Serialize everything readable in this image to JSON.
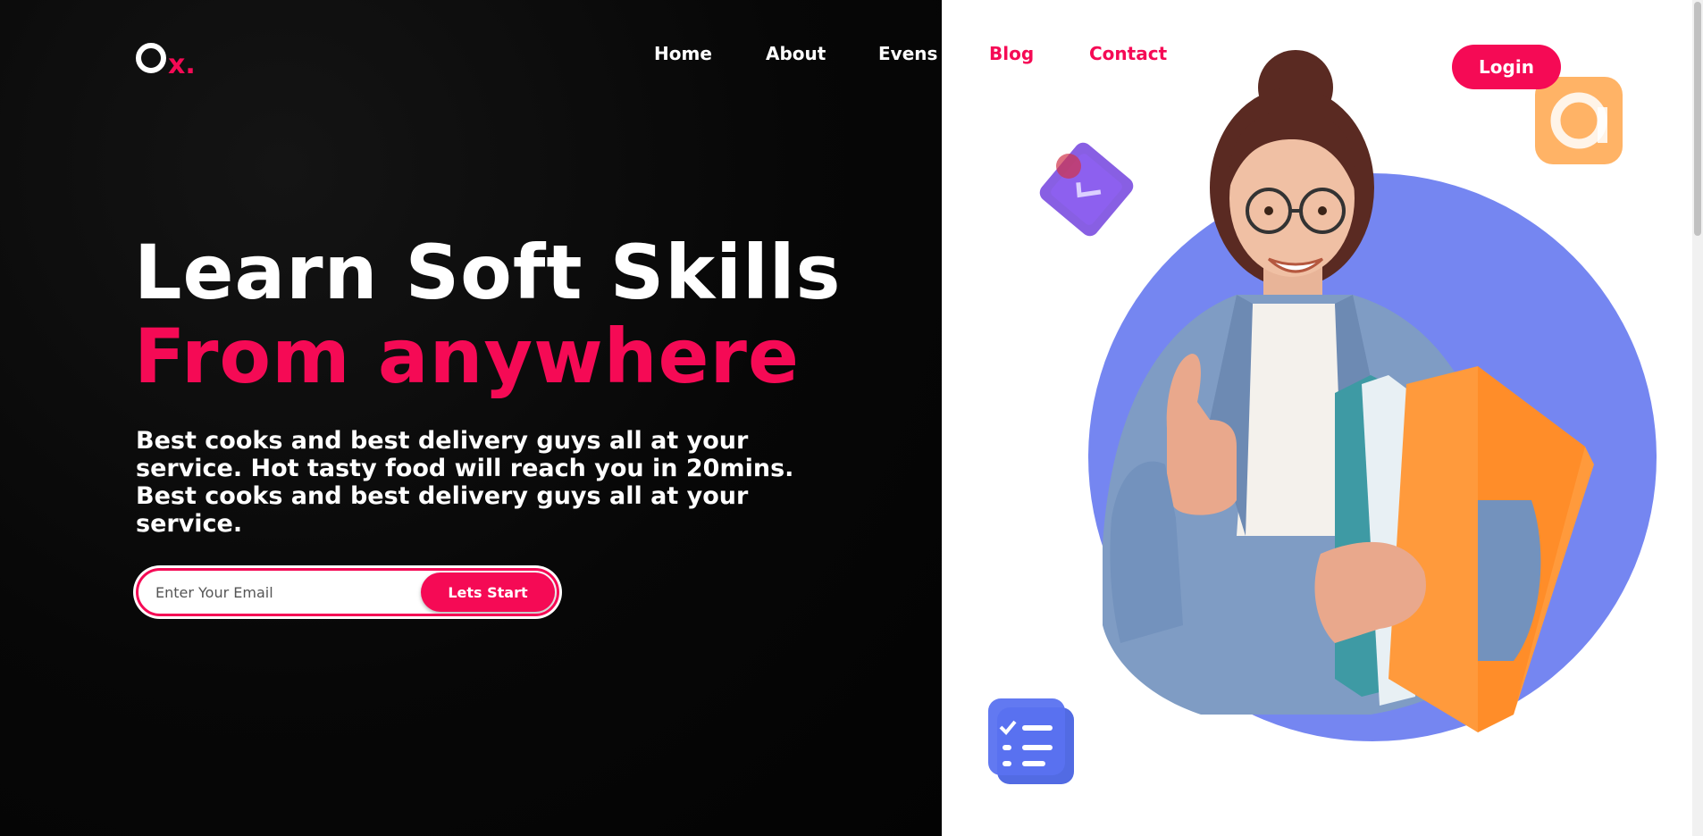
{
  "header": {
    "logo": {
      "letter_o": "O",
      "letter_x": "x."
    },
    "nav": [
      {
        "label": "Home"
      },
      {
        "label": "About"
      },
      {
        "label": "Evens"
      },
      {
        "label": "Blog"
      },
      {
        "label": "Contact"
      }
    ],
    "login_label": "Login"
  },
  "hero": {
    "title_line1": "Learn Soft Skills",
    "title_line2": "From anywhere",
    "description": "Best cooks and best delivery guys all at your service. Hot tasty food will reach you in 20mins. Best cooks and best delivery guys all at your service.",
    "email_placeholder": "Enter Your Email",
    "cta_label": "Lets Start"
  },
  "illustration": {
    "subject": "student-with-books",
    "icons": [
      "calendar-badge-icon",
      "at-sign-badge-icon",
      "checklist-badge-icon"
    ]
  },
  "colors": {
    "accent": "#f50a55",
    "dark_bg": "#050505",
    "circle": "#6e7ff0",
    "orange": "#ffa040",
    "purple": "#7b4ee0"
  }
}
